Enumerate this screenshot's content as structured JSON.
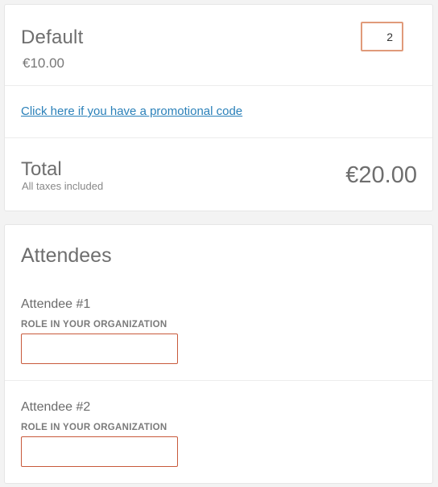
{
  "ticket": {
    "name": "Default",
    "price": "€10.00",
    "quantity": "2"
  },
  "promo": {
    "link_text": "Click here if you have a promotional code"
  },
  "total": {
    "label": "Total",
    "taxes_note": "All taxes included",
    "value": "€20.00"
  },
  "attendees": {
    "title": "Attendees",
    "items": [
      {
        "label": "Attendee #1",
        "field_label": "ROLE IN YOUR ORGANIZATION",
        "field_value": ""
      },
      {
        "label": "Attendee #2",
        "field_label": "ROLE IN YOUR ORGANIZATION",
        "field_value": ""
      }
    ]
  },
  "colors": {
    "link": "#2a80b9",
    "quantity_border": "#e09a7a",
    "input_border_error": "#c8593b"
  }
}
